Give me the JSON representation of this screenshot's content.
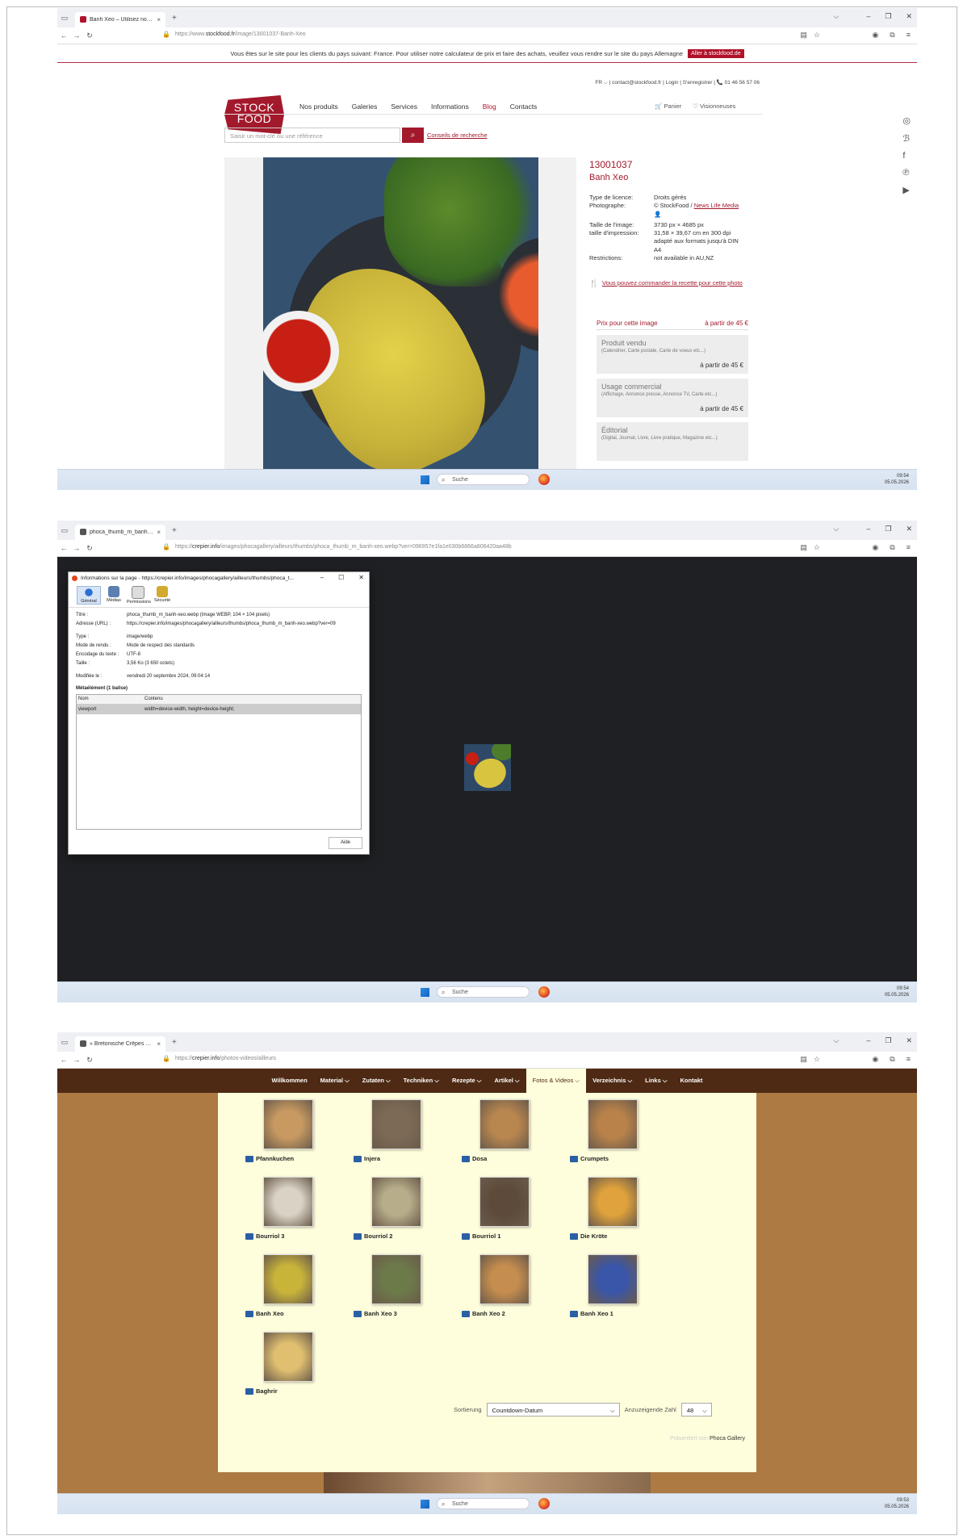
{
  "shots": [
    {
      "tab_title": "Banh Xeo – Utilisez nos images ×",
      "tab_title_text": "Banh Xeo – Utilisez nos images",
      "url_prefix": "https://www.",
      "url_domain": "stockfood.fr",
      "url_rest": "/image/13001037-Banh-Xeo"
    },
    {
      "tab_title_text": "phoca_thumb_m_banh-xeo.we",
      "url_prefix": "https://",
      "url_domain": "crepier.info",
      "url_rest": "/images/phocagallery/ailleurs/thumbs/phoca_thumb_m_banh-xeo.webp?ver=096957e1fa1e030b6866a806420aa48b"
    },
    {
      "tab_title_text": "» Bretonische Crêpes und Galet",
      "url_prefix": "https://",
      "url_domain": "crepier.info",
      "url_rest": "/photos-videos/ailleurs"
    }
  ],
  "taskbar": {
    "search": "Suche",
    "times": [
      "09:54",
      "09:54",
      "09:53"
    ],
    "date": "05.05.2026"
  },
  "stockfood": {
    "notice": "Vous êtes sur le site pour les clients du pays suivant: France. Pour utiliser notre calculateur de prix et faire des achats, veuillez vous rendre sur le site du pays Allemagne",
    "notice_button": "Aller à stockfood.de",
    "toplinks": "FR ⌵ | contact@stockfood.fr | Login | S'enregistrer | 📞 01 46 56 57 06",
    "logo": [
      "STOCK",
      "FOOD"
    ],
    "nav": [
      "Nos produits",
      "Galeries",
      "Services",
      "Informations",
      "Blog",
      "Contacts"
    ],
    "cart": "Panier",
    "views": "Visionneuses",
    "search_placeholder": "Saisir un mot-clé ou une référence",
    "search_tips": "Conseils de recherche",
    "image_id": "13001037",
    "image_title": "Banh Xeo",
    "meta": [
      {
        "k": "Type de licence:",
        "v": "Droits gérés"
      },
      {
        "k": "Photographe:",
        "v": "© StockFood / ",
        "link": "News Life Media"
      },
      {
        "k": "",
        "v": "👤"
      },
      {
        "k": "Taille de l'image:",
        "v": "3730 px × 4685 px"
      },
      {
        "k": "taille d'impression:",
        "v": "31,58 × 39,67 cm en 300 dpi"
      },
      {
        "k": "",
        "v": "adapté aux formats jusqu'à DIN"
      },
      {
        "k": "",
        "v": "A4"
      },
      {
        "k": "Restrictions:",
        "v": "not available in AU,NZ"
      }
    ],
    "recipe_link": "Vous pouvez commander la recette pour cette photo",
    "price_header": "Prix pour cette image",
    "price_from": "à partir de 45 €",
    "price_cards": [
      {
        "title": "Produit vendu",
        "sub": "(Calendrier, Carte postale, Carte de voeux etc...)",
        "price": "à partir de 45 €"
      },
      {
        "title": "Usage commercial",
        "sub": "(Affichage, Annonce presse, Annonce TV, Carte etc...)",
        "price": "à partir de 45 €"
      },
      {
        "title": "Éditorial",
        "sub": "(Digital, Journal, Livre, Livre pratique, Magazine etc...)",
        "price": ""
      }
    ]
  },
  "pageinfo": {
    "title": "Informations sur la page - https://crepier.info/images/phocagallery/ailleurs/thumbs/phoca_t...",
    "tabs": [
      "Général",
      "Médias",
      "Permissions",
      "Sécurité"
    ],
    "rows": [
      {
        "k": "Titre :",
        "v": "phoca_thumb_m_banh-xeo.webp (Image WEBP, 104 × 104 pixels)"
      },
      {
        "k": "Adresse (URL) :",
        "v": "https://crepier.info/images/phocagallery/ailleurs/thumbs/phoca_thumb_m_banh-xeo.webp?ver=09"
      },
      {
        "k": "",
        "v": ""
      },
      {
        "k": "Type :",
        "v": "image/webp"
      },
      {
        "k": "Mode de rendu :",
        "v": "Mode de respect des standards"
      },
      {
        "k": "Encodage du texte :",
        "v": "UTF-8"
      },
      {
        "k": "Taille :",
        "v": "3,56 Ko (3 650 octets)"
      },
      {
        "k": "",
        "v": ""
      },
      {
        "k": "Modifiée le :",
        "v": "vendredi 20 septembre 2024, 09:04:14"
      }
    ],
    "meta_heading": "Métaélément (1 balise)",
    "col_name": "Nom",
    "col_content": "Contenu",
    "meta_row_name": "viewport",
    "meta_row_content": "width=device-width, height=device-height;",
    "help_button": "Aide"
  },
  "crepier": {
    "nav": [
      "Willkommen",
      "Material ⌵",
      "Zutaten ⌵",
      "Techniken ⌵",
      "Rezepte ⌵",
      "Artikel ⌵",
      "Fotos & Videos ⌵",
      "Verzeichnis ⌵",
      "Links ⌵",
      "Kontakt"
    ],
    "items": [
      "Pfannkuchen",
      "Injera",
      "Dosa",
      "Crumpets",
      "Bourriol 3",
      "Bourriol 2",
      "Bourriol 1",
      "Die Kröte",
      "Banh Xeo",
      "Banh Xeo 3",
      "Banh Xeo 2",
      "Banh Xeo 1",
      "Baghrir"
    ],
    "item_colors": [
      "#c89a62",
      "#7c6a55",
      "#b8864f",
      "#b8824a",
      "#d9d3c6",
      "#b7ad8a",
      "#5d4a3a",
      "#e0a23c",
      "#c9b43a",
      "#6c7a4a",
      "#c58d4e",
      "#3a56a8",
      "#e0c070"
    ],
    "sort_label": "Sortierung",
    "sort_value": "Countdown-Datum",
    "count_label": "Anzuzeigende Zahl",
    "count_value": "48",
    "powered_prefix": "Präsentiert von",
    "powered_name": "Phoca Gallery"
  }
}
